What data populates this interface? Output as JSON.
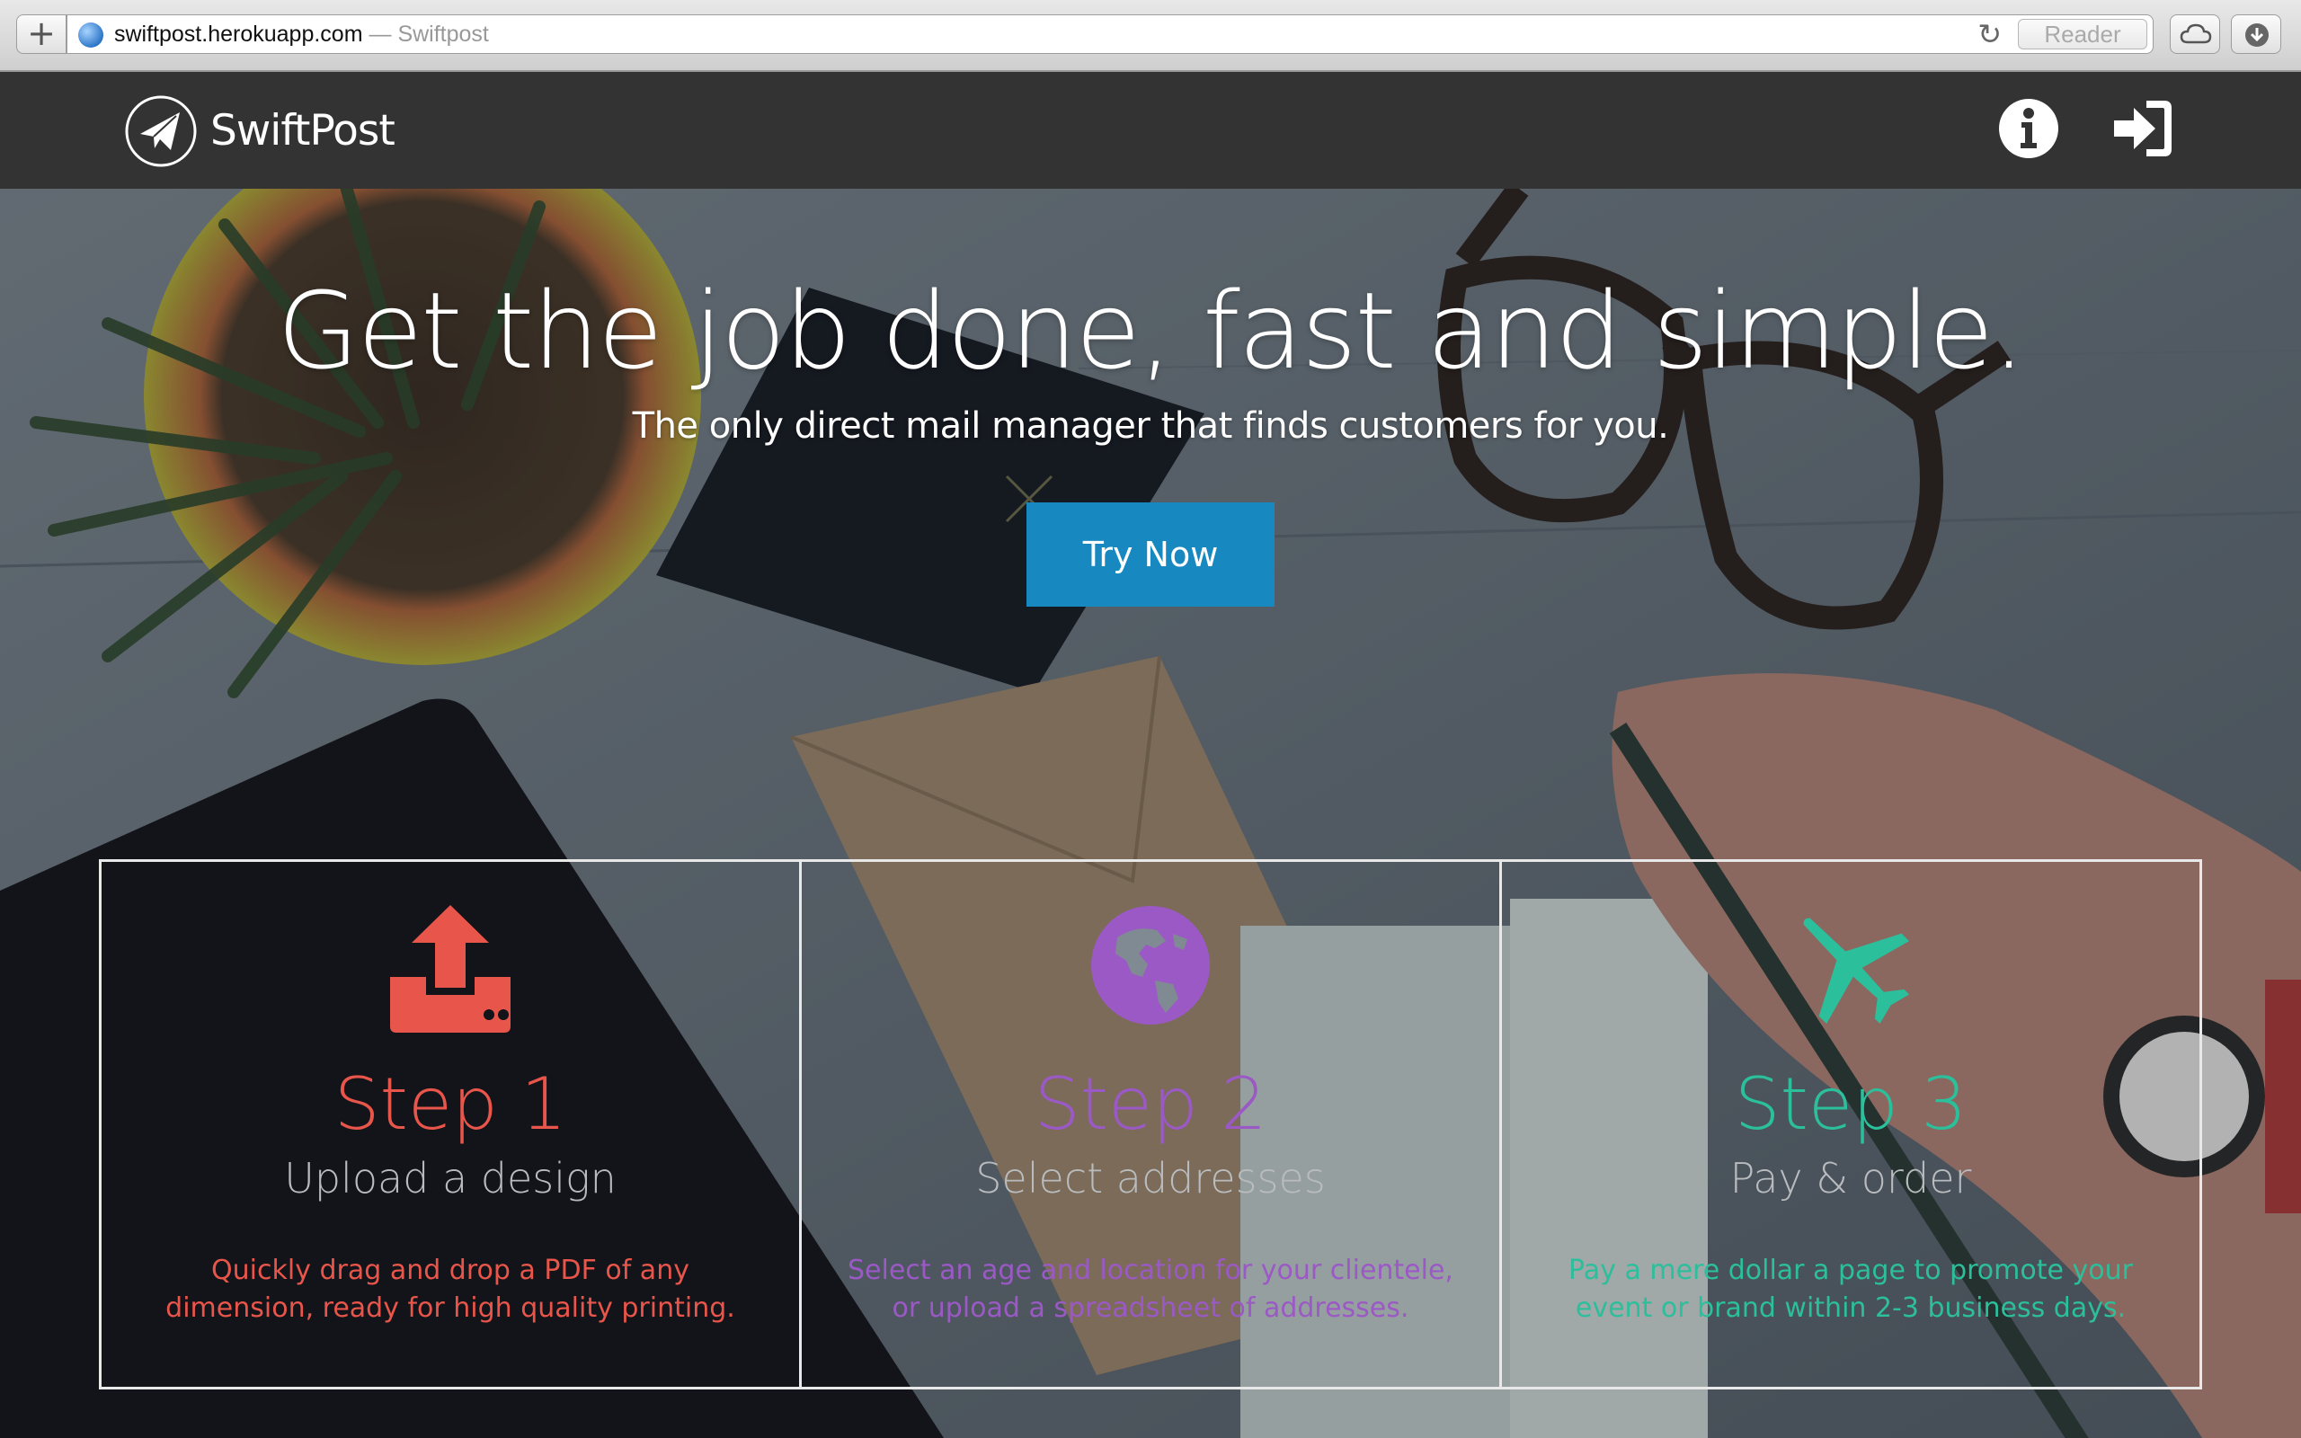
{
  "browser": {
    "new_tab_label": "+",
    "url": "swiftpost.herokuapp.com",
    "url_separator": " — ",
    "page_title": "Swiftpost",
    "reload_glyph": "↻",
    "reader_label": "Reader",
    "icons": [
      "globe-icon",
      "reload-icon",
      "cloud-icon",
      "download-icon"
    ]
  },
  "nav": {
    "brand": "SwiftPost",
    "icons": [
      "paper-plane-logo-icon",
      "info-icon",
      "sign-in-icon"
    ]
  },
  "hero": {
    "headline": "Get the job done, fast and simple.",
    "subheadline": "The only direct mail manager that finds customers for you.",
    "cta_label": "Try Now"
  },
  "steps": [
    {
      "title": "Step 1",
      "subtitle": "Upload a design",
      "description": "Quickly drag and drop a PDF of any dimension, ready for high quality printing.",
      "icon": "upload-icon",
      "color": "#e8554a"
    },
    {
      "title": "Step 2",
      "subtitle": "Select addresses",
      "description": "Select an age and location for your clientele, or upload a spreadsheet of addresses.",
      "icon": "globe-icon",
      "color": "#9b59c6"
    },
    {
      "title": "Step 3",
      "subtitle": "Pay & order",
      "description": "Pay a mere dollar a page to promote your event or brand within 2-3 business days.",
      "icon": "airplane-icon",
      "color": "#2bbf9b"
    }
  ],
  "colors": {
    "navbar": "#333333",
    "cta": "#1888c0",
    "step1": "#e8554a",
    "step2": "#9b59c6",
    "step3": "#2bbf9b"
  }
}
